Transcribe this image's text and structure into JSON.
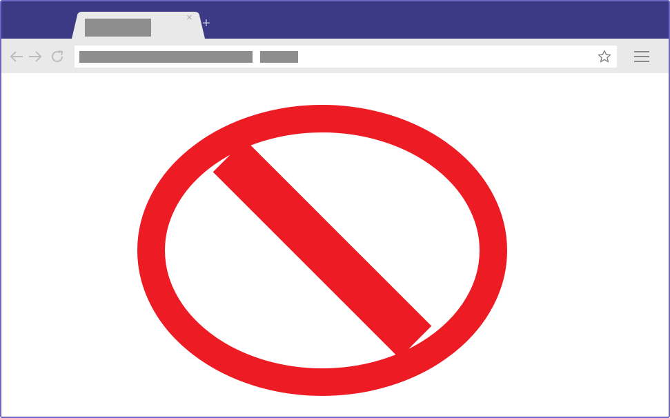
{
  "window": {
    "frame_color": "#6d66c2",
    "tabstrip_color": "#3d3a85",
    "toolbar_color": "#e9e9e9"
  },
  "tabs": [
    {
      "title": "",
      "title_redacted": true,
      "close_label": "×",
      "active": true
    }
  ],
  "new_tab_label": "+",
  "toolbar": {
    "back_icon": "arrow-left-icon",
    "forward_icon": "arrow-right-icon",
    "reload_icon": "reload-icon",
    "bookmark_icon": "star-icon",
    "menu_icon": "hamburger-menu-icon"
  },
  "address_bar": {
    "url": "",
    "url_redacted": true
  },
  "content": {
    "icon": "prohibited-sign-icon",
    "icon_color": "#ed1c24",
    "background": "#ffffff"
  }
}
